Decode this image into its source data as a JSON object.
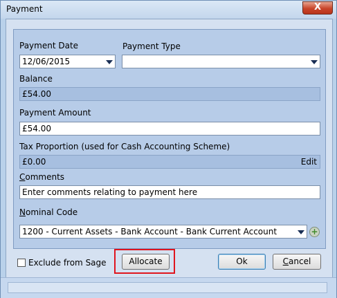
{
  "window": {
    "title": "Payment",
    "close_label": "X"
  },
  "form": {
    "payment_date_label": "Payment Date",
    "payment_date_value": "12/06/2015",
    "payment_type_label": "Payment Type",
    "payment_type_value": "",
    "balance_label": "Balance",
    "balance_value": "£54.00",
    "payment_amount_label": "Payment Amount",
    "payment_amount_value": "£54.00",
    "tax_label": "Tax Proportion (used for Cash Accounting Scheme)",
    "tax_value": "£0.00",
    "tax_edit": "Edit",
    "comments_label_first": "C",
    "comments_label_rest": "omments",
    "comments_value": "Enter comments relating to payment here",
    "nominal_label_first": "N",
    "nominal_label_rest": "ominal Code",
    "nominal_value": "1200 - Current Assets - Bank Account - Bank Current Account"
  },
  "footer": {
    "exclude_label": "Exclude from Sage",
    "exclude_checked": false,
    "allocate_label": "Allocate",
    "ok_label": "Ok",
    "cancel_first": "C",
    "cancel_rest": "ancel"
  },
  "colors": {
    "highlight": "#e0141e",
    "panel": "#b7cce8"
  },
  "icons": {
    "close": "close-icon",
    "dropdown": "chevron-down-icon",
    "add": "plus-icon"
  }
}
